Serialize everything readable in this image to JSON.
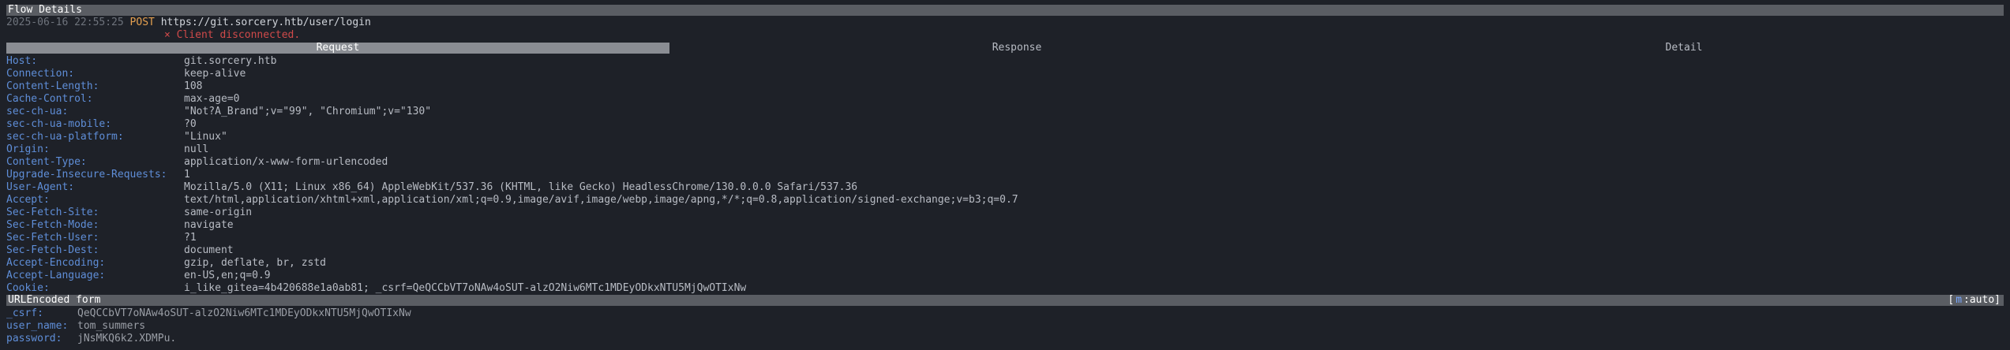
{
  "title_bar": "Flow Details",
  "flow": {
    "timestamp": "2025-06-16 22:55:25",
    "method": "POST",
    "url": "https://git.sorcery.htb/user/login",
    "error": "× Client disconnected."
  },
  "tabs": [
    "Request",
    "Response",
    "Detail"
  ],
  "headers": [
    {
      "k": "Host:",
      "v": "git.sorcery.htb"
    },
    {
      "k": "Connection:",
      "v": "keep-alive"
    },
    {
      "k": "Content-Length:",
      "v": "108"
    },
    {
      "k": "Cache-Control:",
      "v": "max-age=0"
    },
    {
      "k": "sec-ch-ua:",
      "v": "\"Not?A_Brand\";v=\"99\", \"Chromium\";v=\"130\""
    },
    {
      "k": "sec-ch-ua-mobile:",
      "v": "?0"
    },
    {
      "k": "sec-ch-ua-platform:",
      "v": "\"Linux\""
    },
    {
      "k": "Origin:",
      "v": "null"
    },
    {
      "k": "Content-Type:",
      "v": "application/x-www-form-urlencoded"
    },
    {
      "k": "Upgrade-Insecure-Requests:",
      "v": "1"
    },
    {
      "k": "User-Agent:",
      "v": "Mozilla/5.0 (X11; Linux x86_64) AppleWebKit/537.36 (KHTML, like Gecko) HeadlessChrome/130.0.0.0 Safari/537.36"
    },
    {
      "k": "Accept:",
      "v": "text/html,application/xhtml+xml,application/xml;q=0.9,image/avif,image/webp,image/apng,*/*;q=0.8,application/signed-exchange;v=b3;q=0.7"
    },
    {
      "k": "Sec-Fetch-Site:",
      "v": "same-origin"
    },
    {
      "k": "Sec-Fetch-Mode:",
      "v": "navigate"
    },
    {
      "k": "Sec-Fetch-User:",
      "v": "?1"
    },
    {
      "k": "Sec-Fetch-Dest:",
      "v": "document"
    },
    {
      "k": "Accept-Encoding:",
      "v": "gzip, deflate, br, zstd"
    },
    {
      "k": "Accept-Language:",
      "v": "en-US,en;q=0.9"
    },
    {
      "k": "Cookie:",
      "v": "i_like_gitea=4b420688e1a0ab81; _csrf=QeQCCbVT7oNAw4oSUT-alzO2Niw6MTc1MDEyODkxNTU5MjQwOTIxNw"
    }
  ],
  "form_bar": {
    "title": "URLEncoded form",
    "mode_open": "[",
    "mode_key": "m",
    "mode_rest": ":auto]"
  },
  "form": [
    {
      "k": "_csrf:",
      "v": "QeQCCbVT7oNAw4oSUT-alzO2Niw6MTc1MDEyODkxNTU5MjQwOTIxNw"
    },
    {
      "k": "user_name:",
      "v": "tom_summers"
    },
    {
      "k": "password:",
      "v": "jNsMKQ6k2.XDMPu."
    }
  ]
}
